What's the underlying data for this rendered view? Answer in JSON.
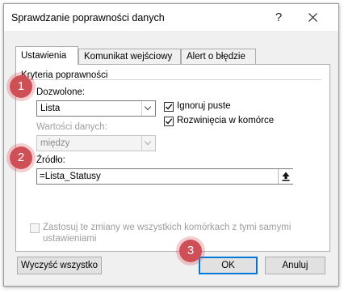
{
  "window": {
    "title": "Sprawdzanie poprawności danych",
    "help_label": "?",
    "close_label": "✕"
  },
  "tabs": [
    {
      "label": "Ustawienia",
      "active": true
    },
    {
      "label": "Komunikat wejściowy",
      "active": false
    },
    {
      "label": "Alert o błędzie",
      "active": false
    }
  ],
  "criteria": {
    "group_title": "Kryteria poprawności",
    "allow_label": "Dozwolone:",
    "allow_value": "Lista",
    "data_label": "Wartości danych:",
    "data_value": "między",
    "ignore_blank": {
      "label": "Ignoruj puste",
      "checked": true
    },
    "in_cell_dropdown": {
      "label": "Rozwinięcia w komórce",
      "checked": true
    },
    "source_label": "Źródło:",
    "source_value": "=Lista_Statusy",
    "source_ref_icon": "collapse-dialog-arrow-icon"
  },
  "apply_all": {
    "line1": "Zastosuj te zmiany we wszystkich komórkach z tymi samymi",
    "line2": "ustawieniami",
    "checked": false
  },
  "buttons": {
    "clear_all": "Wyczyść wszystko",
    "ok": "OK",
    "cancel": "Anuluj"
  },
  "badges": [
    "1",
    "2",
    "3"
  ],
  "colors": {
    "badge": "#cf4f57",
    "focus_border": "#0078d7",
    "dialog_bg": "#f0f0f0"
  }
}
